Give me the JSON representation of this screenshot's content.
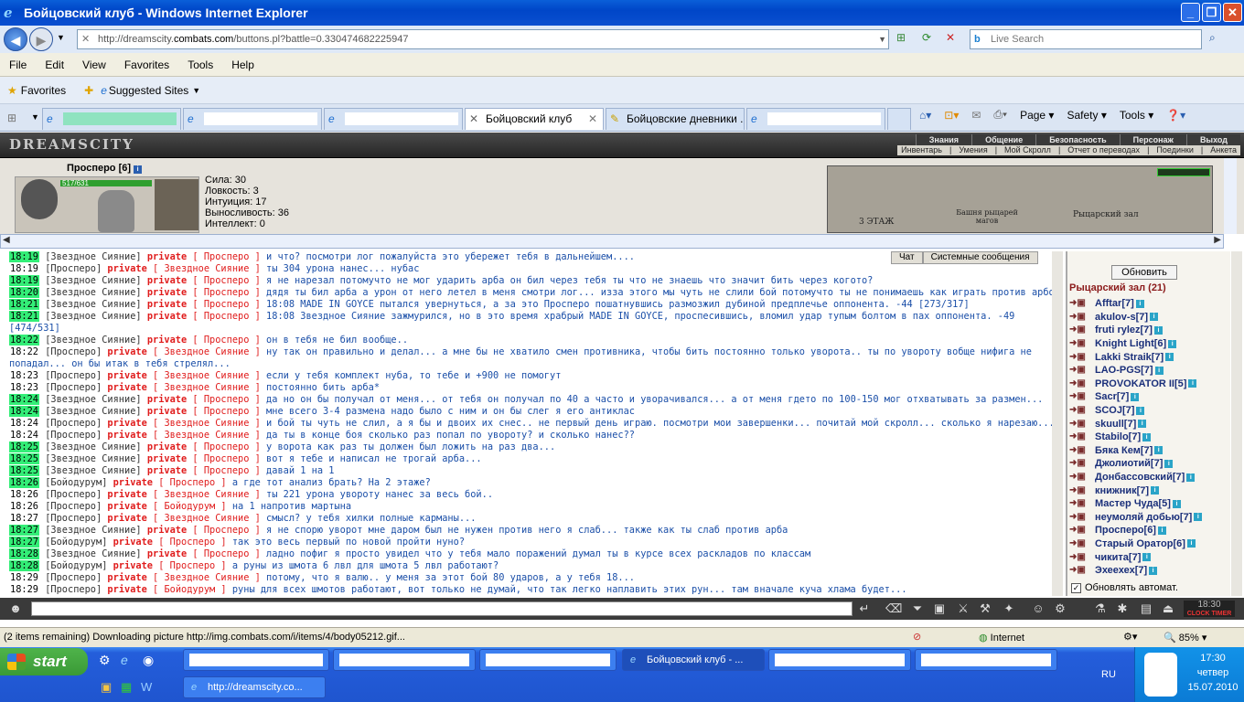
{
  "window": {
    "title": "Бойцовский клуб - Windows Internet Explorer"
  },
  "address": {
    "prefix": "http://dreamscity.",
    "domain": "combats.com",
    "rest": "/buttons.pl?battle=0.330474682225947"
  },
  "search": {
    "placeholder": "Live Search"
  },
  "menu": [
    "File",
    "Edit",
    "View",
    "Favorites",
    "Tools",
    "Help"
  ],
  "favbar": {
    "favorites": "Favorites",
    "suggested": "Suggested Sites"
  },
  "tabs": [
    {
      "label": "",
      "hidden": true,
      "highlight": "green"
    },
    {
      "label": "",
      "hidden": true
    },
    {
      "label": "",
      "hidden": true
    },
    {
      "label": "Бойцовский клуб",
      "active": true
    },
    {
      "label": "Бойцовские дневники ..."
    },
    {
      "label": "",
      "hidden": true
    }
  ],
  "cmdbar": {
    "page": "Page",
    "safety": "Safety",
    "tools": "Tools"
  },
  "game": {
    "logo": "DREAMSCITY",
    "topmenu": [
      "Знания",
      "Общение",
      "Безопасность",
      "Персонаж",
      "Выход"
    ],
    "submenu": [
      "Инвентарь",
      "|",
      "Умения",
      "|",
      "Мой Скролл",
      "|",
      "Отчет о переводах",
      "|",
      "Поединки",
      "|",
      "Анкета"
    ],
    "char": {
      "name": "Просперо",
      "level": "[6]",
      "hp": "517/631"
    },
    "stats": [
      "Сила: 30",
      "Ловкость: 3",
      "Интуиция: 17",
      "Выносливость: 36",
      "Интеллект: 0"
    ],
    "map": {
      "floor": "3 ЭТАЖ",
      "tower": "Башня рыцарей магов",
      "hall": "Рыцарский зал"
    }
  },
  "chat_tabs": [
    "Чат",
    "Системные сообщения"
  ],
  "chat": [
    {
      "t": "18:19",
      "hl": true,
      "from": "Звездное Сияние",
      "to": "Просперо",
      "msg": "и что? посмотри лог пожалуйста это убережет тебя в дальнейшем...."
    },
    {
      "t": "18:19",
      "hl": false,
      "from": "Просперо",
      "to": "Звездное Сияние",
      "msg": "ты 304 урона нанес... нубас"
    },
    {
      "t": "18:19",
      "hl": true,
      "from": "Звездное Сияние",
      "to": "Просперо",
      "msg": "я не нарезал потомучто не мог ударить арба он бил через тебя ты что не знаешь что значит бить через когото?"
    },
    {
      "t": "18:20",
      "hl": true,
      "from": "Звездное Сияние",
      "to": "Просперо",
      "msg": "дядя ты бил арба а урон от него летел в меня смотри лог... изза этого мы чуть не слили бой потомучто ты не понимаешь как играть против арбов"
    },
    {
      "t": "18:21",
      "hl": true,
      "from": "Звездное Сияние",
      "to": "Просперо",
      "msg": "18:08 MADE IN GOYCE пытался увернуться, а за это Просперо пошатнувшись размозжил дубиной предплечье оппонента. -44 [273/317]"
    },
    {
      "t": "18:21",
      "hl": true,
      "from": "Звездное Сияние",
      "to": "Просперо",
      "msg": "18:08 Звездное Сияние зажмурился, но в это время храбрый MADE IN GOYCE, проспесившись, вломил удар тупым болтом в пах оппонента. -49 [474/531]",
      "wrap": true
    },
    {
      "t": "18:22",
      "hl": true,
      "from": "Звездное Сияние",
      "to": "Просперо",
      "msg": "он в тебя не бил вообще.."
    },
    {
      "t": "18:22",
      "hl": false,
      "from": "Просперо",
      "to": "Звездное Сияние",
      "msg": "ну так он правильно и делал... а мне бы не хватило смен противника, чтобы бить постоянно только уворота.. ты по увороту вобще нифига не попадал... он бы итак в тебя стрелял...",
      "wrap": true
    },
    {
      "t": "18:23",
      "hl": false,
      "from": "Просперо",
      "to": "Звездное Сияние",
      "msg": "если у тебя комплект нуба, то тебе и +900 не помогут"
    },
    {
      "t": "18:23",
      "hl": false,
      "from": "Просперо",
      "to": "Звездное Сияние",
      "msg": "постоянно бить арба*"
    },
    {
      "t": "18:24",
      "hl": true,
      "from": "Звездное Сияние",
      "to": "Просперо",
      "msg": "да но он бы получал от меня... от тебя он получал по 40 а часто и уворачивался... а от меня гдето по 100-150 мог отхватывать за размен..."
    },
    {
      "t": "18:24",
      "hl": true,
      "from": "Звездное Сияние",
      "to": "Просперо",
      "msg": "мне всего 3-4 размена надо было с ним и он бы слег я его антиклас"
    },
    {
      "t": "18:24",
      "hl": false,
      "from": "Просперо",
      "to": "Звездное Сияние",
      "msg": "и бой ты чуть не слил, а я бы и двоих их снес.. не первый день играю. посмотри мои завершенки... почитай мой скролл... сколько я нарезаю..."
    },
    {
      "t": "18:24",
      "hl": false,
      "from": "Просперо",
      "to": "Звездное Сияние",
      "msg": "да ты в конце боя сколько раз попал по увороту? и сколько нанес??"
    },
    {
      "t": "18:25",
      "hl": true,
      "from": "Звездное Сияние",
      "to": "Просперо",
      "msg": "у ворота как раз ты должен был ложить на раз два..."
    },
    {
      "t": "18:25",
      "hl": true,
      "from": "Звездное Сияние",
      "to": "Просперо",
      "msg": "вот я тебе и написал не трогай арба..."
    },
    {
      "t": "18:25",
      "hl": true,
      "from": "Звездное Сияние",
      "to": "Просперо",
      "msg": "давай 1 на 1"
    },
    {
      "t": "18:26",
      "hl": true,
      "from": "Бойодурум",
      "to": "Просперо",
      "msg": "а где тот анализ брать? На 2 этаже?"
    },
    {
      "t": "18:26",
      "hl": false,
      "from": "Просперо",
      "to": "Звездное Сияние",
      "msg": "ты 221 урона увороту нанес за весь бой.."
    },
    {
      "t": "18:26",
      "hl": false,
      "from": "Просперо",
      "to": "Бойодурум",
      "msg": "на 1 напротив мартына"
    },
    {
      "t": "18:27",
      "hl": false,
      "from": "Просперо",
      "to": "Звездное Сияние",
      "msg": "смысл? у тебя хилки полные карманы..."
    },
    {
      "t": "18:27",
      "hl": true,
      "from": "Звездное Сияние",
      "to": "Просперо",
      "msg": "я не спорю уворот мне даром был не нужен против него я слаб... также как ты слаб против арба"
    },
    {
      "t": "18:27",
      "hl": true,
      "from": "Бойодурум",
      "to": "Просперо",
      "msg": "так это весь первый по новой пройти нуно?"
    },
    {
      "t": "18:28",
      "hl": true,
      "from": "Звездное Сияние",
      "to": "Просперо",
      "msg": "ладно пофиг я просто увидел что у тебя мало поражений думал ты в курсе всех раскладов по классам"
    },
    {
      "t": "18:28",
      "hl": true,
      "from": "Бойодурум",
      "to": "Просперо",
      "msg": "а руны из шмота 6 лвл для шмота 5 лвл работают?"
    },
    {
      "t": "18:29",
      "hl": false,
      "from": "Просперо",
      "to": "Звездное Сияние",
      "msg": "потому, что я валю.. у меня за этот бой 80 ударов, а у тебя 18..."
    },
    {
      "t": "18:29",
      "hl": false,
      "from": "Просперо",
      "to": "Бойодурум",
      "msg": "руны для всех шмотов работают, вот только не думай, что так легко наплавить этих рун... там вначале куча хлама будет..."
    }
  ],
  "right": {
    "refresh": "Обновить",
    "room": "Рыцарский зал (21)",
    "users": [
      {
        "name": "Afftar",
        "lvl": "[7]"
      },
      {
        "name": "akulov-s",
        "lvl": "[7]"
      },
      {
        "name": "fruti rylez",
        "lvl": "[7]"
      },
      {
        "name": "Knight Light",
        "lvl": "[6]"
      },
      {
        "name": "Lakki Straik",
        "lvl": "[7]"
      },
      {
        "name": "LAO-PGS",
        "lvl": "[7]"
      },
      {
        "name": "PROVOKATOR II",
        "lvl": "[5]"
      },
      {
        "name": "Sacr",
        "lvl": "[7]"
      },
      {
        "name": "SCOJ",
        "lvl": "[7]"
      },
      {
        "name": "skuull",
        "lvl": "[7]"
      },
      {
        "name": "Stabilo",
        "lvl": "[7]"
      },
      {
        "name": "Бяка Кем",
        "lvl": "[7]"
      },
      {
        "name": "Джолиотий",
        "lvl": "[7]"
      },
      {
        "name": "Донбассовский",
        "lvl": "[7]"
      },
      {
        "name": "книжник",
        "lvl": "[7]"
      },
      {
        "name": "Мастер Чуда",
        "lvl": "[5]"
      },
      {
        "name": "неумоляй добью",
        "lvl": "[7]"
      },
      {
        "name": "Просперо",
        "lvl": "[6]"
      },
      {
        "name": "Старый Оратор",
        "lvl": "[6]"
      },
      {
        "name": "чикита",
        "lvl": "[7]"
      },
      {
        "name": "Эхеехех",
        "lvl": "[7]"
      }
    ],
    "auto": "Обновлять автомат."
  },
  "clock": {
    "time": "18:30",
    "label": "CLOCK TIMER"
  },
  "status": {
    "text": "(2 items remaining) Downloading picture http://img.combats.com/i/items/4/body05212.gif...",
    "zone": "Internet",
    "zoom": "85%"
  },
  "taskbar": {
    "start": "start",
    "active_task": "Бойцовский клуб - ...",
    "task2": "http://dreamscity.co...",
    "lang": "RU",
    "time": "17:30",
    "day": "четвер",
    "date": "15.07.2010"
  }
}
